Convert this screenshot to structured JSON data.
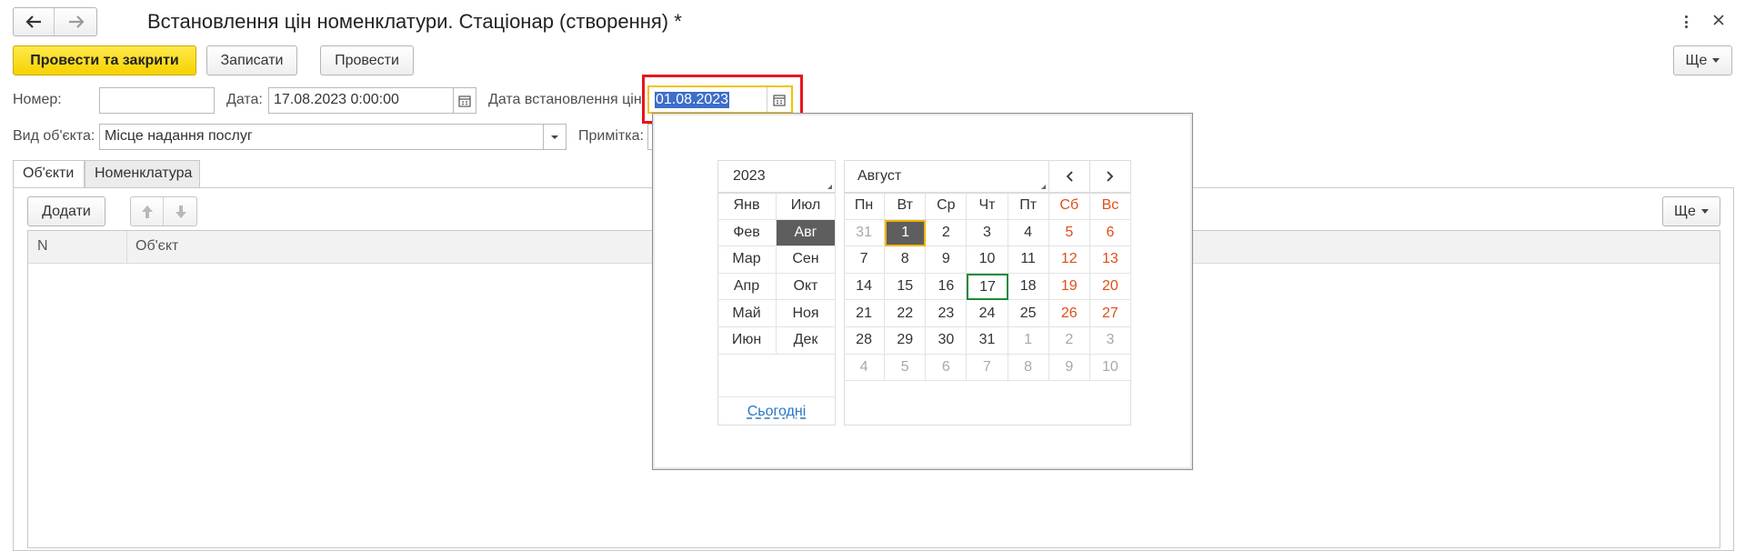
{
  "window": {
    "title": "Встановлення цін номенклатури. Стаціонар (створення) *",
    "nav_back_icon": "arrow-left-icon",
    "nav_forward_icon": "arrow-right-icon",
    "menu_icon": "kebab-icon",
    "close_icon": "close-icon"
  },
  "toolbar": {
    "post_and_close": "Провести та закрити",
    "save": "Записати",
    "post": "Провести",
    "more": "Ще"
  },
  "form": {
    "number_label": "Номер:",
    "number_value": "",
    "date_label": "Дата:",
    "date_value": "17.08.2023  0:00:00",
    "price_date_label": "Дата встановлення цін:",
    "price_date_value": "01.08.2023",
    "object_type_label": "Вид об'єкта:",
    "object_type_value": "Місце надання послуг",
    "note_label": "Примітка:"
  },
  "tabs": [
    "Об'єкти",
    "Номенклатура"
  ],
  "table": {
    "add_button": "Додати",
    "more_button": "Ще",
    "columns": [
      "N",
      "Об'єкт"
    ]
  },
  "calendar": {
    "year": "2023",
    "month": "Август",
    "prev_icon": "chevron-left-icon",
    "next_icon": "chevron-right-icon",
    "months_left": [
      "Янв",
      "Фев",
      "Мар",
      "Апр",
      "Май",
      "Июн"
    ],
    "months_right": [
      "Июл",
      "Авг",
      "Сен",
      "Окт",
      "Ноя",
      "Дек"
    ],
    "today_link": "Сьогодні",
    "weekdays": [
      "Пн",
      "Вт",
      "Ср",
      "Чт",
      "Пт",
      "Сб",
      "Вс"
    ],
    "weeks": [
      [
        "31",
        "1",
        "2",
        "3",
        "4",
        "5",
        "6"
      ],
      [
        "7",
        "8",
        "9",
        "10",
        "11",
        "12",
        "13"
      ],
      [
        "14",
        "15",
        "16",
        "17",
        "18",
        "19",
        "20"
      ],
      [
        "21",
        "22",
        "23",
        "24",
        "25",
        "26",
        "27"
      ],
      [
        "28",
        "29",
        "30",
        "31",
        "1",
        "2",
        "3"
      ],
      [
        "4",
        "5",
        "6",
        "7",
        "8",
        "9",
        "10"
      ]
    ],
    "selected_day": "1",
    "today_day": "17",
    "colors": {
      "weekend": "#e04e1a",
      "selected_bg": "#5e5e5e",
      "selected_border": "#f0b400",
      "today_border": "#1f8a3a",
      "highlight": "#e8141b"
    }
  }
}
